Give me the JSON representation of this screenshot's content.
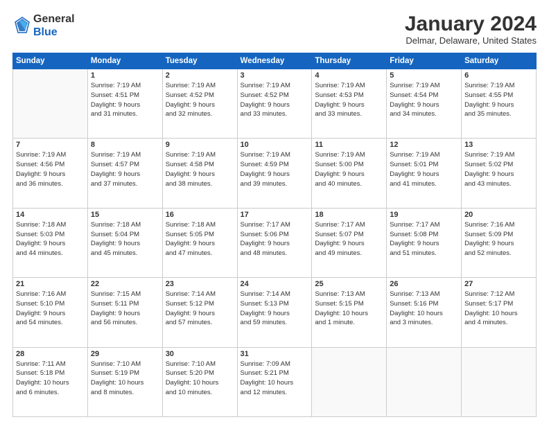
{
  "logo": {
    "line1": "General",
    "line2": "Blue"
  },
  "title": "January 2024",
  "subtitle": "Delmar, Delaware, United States",
  "days_header": [
    "Sunday",
    "Monday",
    "Tuesday",
    "Wednesday",
    "Thursday",
    "Friday",
    "Saturday"
  ],
  "weeks": [
    [
      {
        "num": "",
        "info": ""
      },
      {
        "num": "1",
        "info": "Sunrise: 7:19 AM\nSunset: 4:51 PM\nDaylight: 9 hours\nand 31 minutes."
      },
      {
        "num": "2",
        "info": "Sunrise: 7:19 AM\nSunset: 4:52 PM\nDaylight: 9 hours\nand 32 minutes."
      },
      {
        "num": "3",
        "info": "Sunrise: 7:19 AM\nSunset: 4:52 PM\nDaylight: 9 hours\nand 33 minutes."
      },
      {
        "num": "4",
        "info": "Sunrise: 7:19 AM\nSunset: 4:53 PM\nDaylight: 9 hours\nand 33 minutes."
      },
      {
        "num": "5",
        "info": "Sunrise: 7:19 AM\nSunset: 4:54 PM\nDaylight: 9 hours\nand 34 minutes."
      },
      {
        "num": "6",
        "info": "Sunrise: 7:19 AM\nSunset: 4:55 PM\nDaylight: 9 hours\nand 35 minutes."
      }
    ],
    [
      {
        "num": "7",
        "info": "Sunrise: 7:19 AM\nSunset: 4:56 PM\nDaylight: 9 hours\nand 36 minutes."
      },
      {
        "num": "8",
        "info": "Sunrise: 7:19 AM\nSunset: 4:57 PM\nDaylight: 9 hours\nand 37 minutes."
      },
      {
        "num": "9",
        "info": "Sunrise: 7:19 AM\nSunset: 4:58 PM\nDaylight: 9 hours\nand 38 minutes."
      },
      {
        "num": "10",
        "info": "Sunrise: 7:19 AM\nSunset: 4:59 PM\nDaylight: 9 hours\nand 39 minutes."
      },
      {
        "num": "11",
        "info": "Sunrise: 7:19 AM\nSunset: 5:00 PM\nDaylight: 9 hours\nand 40 minutes."
      },
      {
        "num": "12",
        "info": "Sunrise: 7:19 AM\nSunset: 5:01 PM\nDaylight: 9 hours\nand 41 minutes."
      },
      {
        "num": "13",
        "info": "Sunrise: 7:19 AM\nSunset: 5:02 PM\nDaylight: 9 hours\nand 43 minutes."
      }
    ],
    [
      {
        "num": "14",
        "info": "Sunrise: 7:18 AM\nSunset: 5:03 PM\nDaylight: 9 hours\nand 44 minutes."
      },
      {
        "num": "15",
        "info": "Sunrise: 7:18 AM\nSunset: 5:04 PM\nDaylight: 9 hours\nand 45 minutes."
      },
      {
        "num": "16",
        "info": "Sunrise: 7:18 AM\nSunset: 5:05 PM\nDaylight: 9 hours\nand 47 minutes."
      },
      {
        "num": "17",
        "info": "Sunrise: 7:17 AM\nSunset: 5:06 PM\nDaylight: 9 hours\nand 48 minutes."
      },
      {
        "num": "18",
        "info": "Sunrise: 7:17 AM\nSunset: 5:07 PM\nDaylight: 9 hours\nand 49 minutes."
      },
      {
        "num": "19",
        "info": "Sunrise: 7:17 AM\nSunset: 5:08 PM\nDaylight: 9 hours\nand 51 minutes."
      },
      {
        "num": "20",
        "info": "Sunrise: 7:16 AM\nSunset: 5:09 PM\nDaylight: 9 hours\nand 52 minutes."
      }
    ],
    [
      {
        "num": "21",
        "info": "Sunrise: 7:16 AM\nSunset: 5:10 PM\nDaylight: 9 hours\nand 54 minutes."
      },
      {
        "num": "22",
        "info": "Sunrise: 7:15 AM\nSunset: 5:11 PM\nDaylight: 9 hours\nand 56 minutes."
      },
      {
        "num": "23",
        "info": "Sunrise: 7:14 AM\nSunset: 5:12 PM\nDaylight: 9 hours\nand 57 minutes."
      },
      {
        "num": "24",
        "info": "Sunrise: 7:14 AM\nSunset: 5:13 PM\nDaylight: 9 hours\nand 59 minutes."
      },
      {
        "num": "25",
        "info": "Sunrise: 7:13 AM\nSunset: 5:15 PM\nDaylight: 10 hours\nand 1 minute."
      },
      {
        "num": "26",
        "info": "Sunrise: 7:13 AM\nSunset: 5:16 PM\nDaylight: 10 hours\nand 3 minutes."
      },
      {
        "num": "27",
        "info": "Sunrise: 7:12 AM\nSunset: 5:17 PM\nDaylight: 10 hours\nand 4 minutes."
      }
    ],
    [
      {
        "num": "28",
        "info": "Sunrise: 7:11 AM\nSunset: 5:18 PM\nDaylight: 10 hours\nand 6 minutes."
      },
      {
        "num": "29",
        "info": "Sunrise: 7:10 AM\nSunset: 5:19 PM\nDaylight: 10 hours\nand 8 minutes."
      },
      {
        "num": "30",
        "info": "Sunrise: 7:10 AM\nSunset: 5:20 PM\nDaylight: 10 hours\nand 10 minutes."
      },
      {
        "num": "31",
        "info": "Sunrise: 7:09 AM\nSunset: 5:21 PM\nDaylight: 10 hours\nand 12 minutes."
      },
      {
        "num": "",
        "info": ""
      },
      {
        "num": "",
        "info": ""
      },
      {
        "num": "",
        "info": ""
      }
    ]
  ]
}
